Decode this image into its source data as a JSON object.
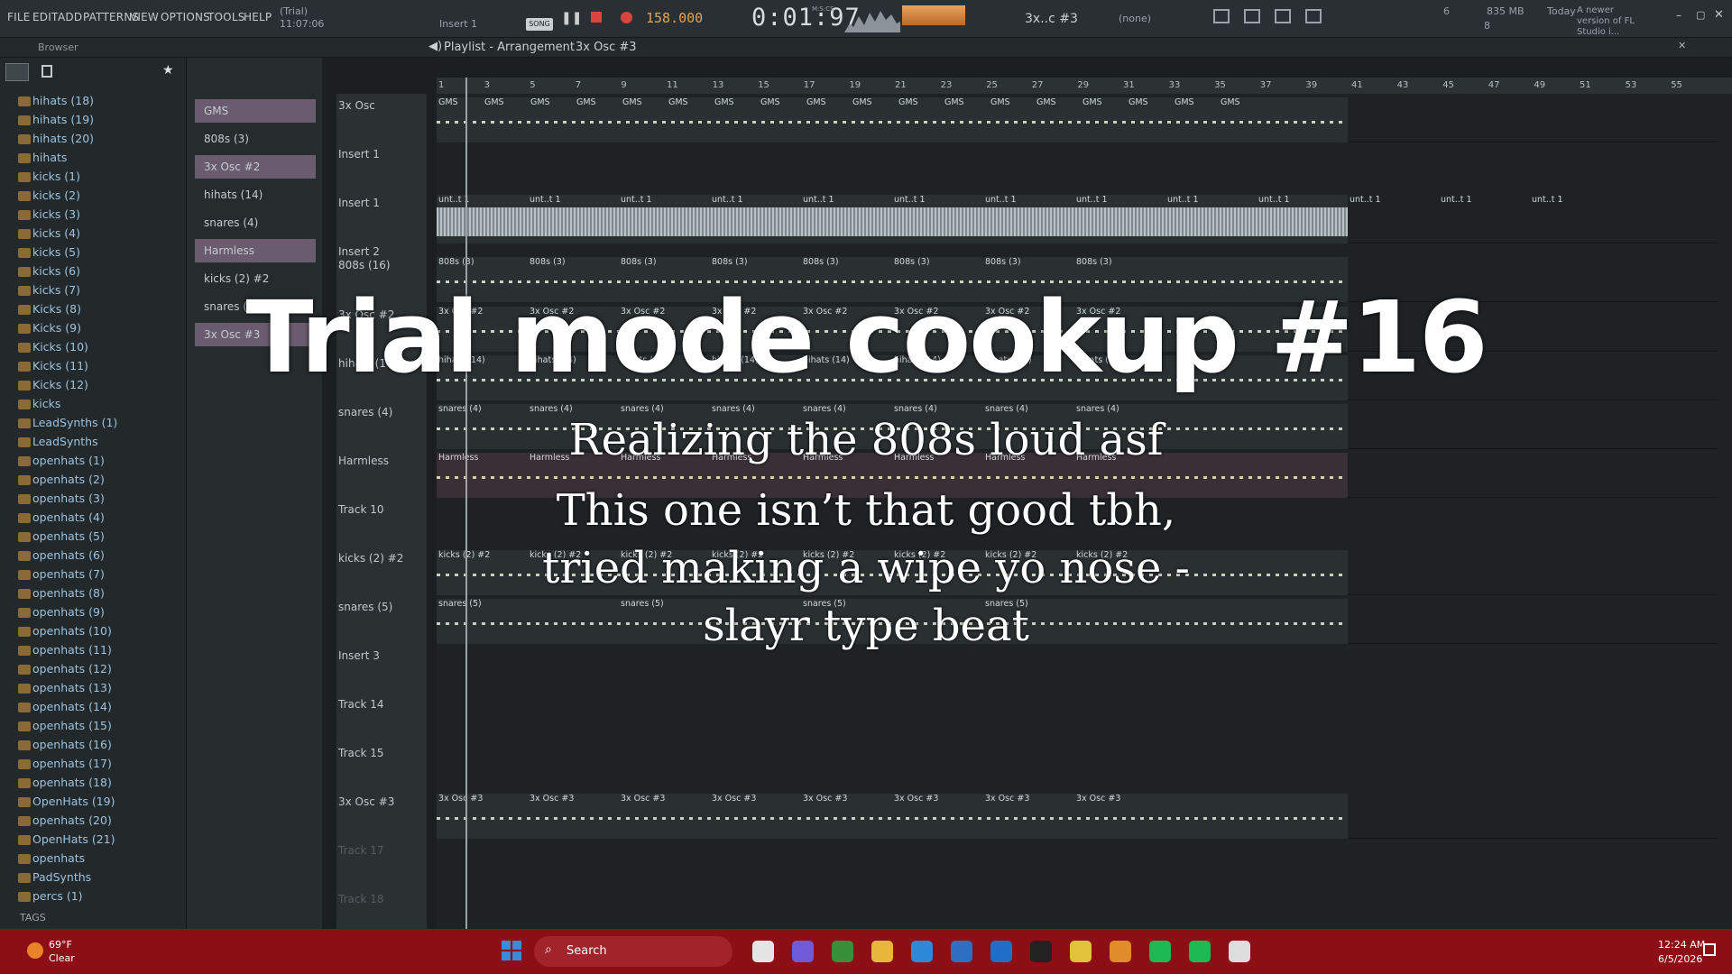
{
  "menu": [
    "FILE",
    "EDIT",
    "ADD",
    "PATTERNS",
    "VIEW",
    "OPTIONS",
    "TOOLS",
    "HELP"
  ],
  "trial": {
    "label": "(Trial)",
    "time": "11:07:06"
  },
  "transport": {
    "insert": "Insert 1",
    "pat_song": "SONG",
    "tempo": "158.000",
    "time": "0:01:97",
    "time_unit": "M:S:CS",
    "pattern": "3x..c #3",
    "none": "(none)"
  },
  "status": {
    "cpu": "6",
    "mem": "835 MB",
    "poly": "8",
    "news_when": "Today",
    "news_text": "A newer version of FL Studio i..."
  },
  "browser": {
    "title": "Browser",
    "tags_label": "TAGS",
    "items": [
      "hihats (18)",
      "hihats (19)",
      "hihats (20)",
      "hihats",
      "kicks (1)",
      "kicks (2)",
      "kicks (3)",
      "kicks (4)",
      "kicks (5)",
      "kicks (6)",
      "kicks (7)",
      "Kicks (8)",
      "Kicks (9)",
      "Kicks (10)",
      "Kicks (11)",
      "Kicks (12)",
      "kicks",
      "LeadSynths (1)",
      "LeadSynths",
      "openhats (1)",
      "openhats (2)",
      "openhats (3)",
      "openhats (4)",
      "openhats (5)",
      "openhats (6)",
      "openhats (7)",
      "openhats (8)",
      "openhats (9)",
      "openhats (10)",
      "openhats (11)",
      "openhats (12)",
      "openhats (13)",
      "openhats (14)",
      "openhats (15)",
      "openhats (16)",
      "openhats (17)",
      "openhats (18)",
      "OpenHats (19)",
      "openhats (20)",
      "OpenHats (21)",
      "openhats",
      "PadSynths",
      "percs (1)"
    ]
  },
  "picker": [
    "GMS",
    "808s (3)",
    "3x Osc #2",
    "hihats (14)",
    "snares (4)",
    "Harmless",
    "kicks (2) #2",
    "snares (5)",
    "3x Osc #3"
  ],
  "playlist": {
    "title": "Playlist - Arrangement",
    "pattern": "3x Osc #3"
  },
  "ruler": [
    "1",
    "3",
    "5",
    "7",
    "9",
    "11",
    "13",
    "15",
    "17",
    "19",
    "21",
    "23",
    "25",
    "27",
    "29",
    "31",
    "33",
    "35",
    "37",
    "39",
    "41",
    "43",
    "45",
    "47",
    "49",
    "51",
    "53",
    "55"
  ],
  "tracks": [
    "3x Osc",
    "Insert 1",
    "Insert 1",
    "Insert 2",
    "808s (16)",
    "3x Osc #2",
    "hihats (14)",
    "snares (4)",
    "Harmless",
    "Track 10",
    "kicks (2) #2",
    "snares (5)",
    "Insert 3",
    "Track 14",
    "Track 15",
    "3x Osc #3",
    "Track 17",
    "Track 18"
  ],
  "clips": {
    "gms": "GMS",
    "unt": "unt..t 1",
    "s808": "808s (3)",
    "osc2": "3x Osc #2",
    "hihats": "hihats (14)",
    "snares4": "snares (4)",
    "harmless": "Harmless",
    "kicks": "kicks (2) #2",
    "snares5": "snares (5)",
    "osc3": "3x Osc #3"
  },
  "overlay": {
    "title": "Trial mode cookup #16",
    "line1": "Realizing the 808s loud asf",
    "line2": "This one isn’t that good tbh,",
    "line3": "tried making a wipe yo nose -",
    "line4": "slayr type beat"
  },
  "taskbar": {
    "temp": "69°F",
    "weather": "Clear",
    "search": "Search",
    "time": "12:24 AM",
    "date": "6/5/2026"
  },
  "colors": {
    "accent": "#8b0f15",
    "clip": "#4e5356",
    "selected": "#6b5b6e"
  }
}
